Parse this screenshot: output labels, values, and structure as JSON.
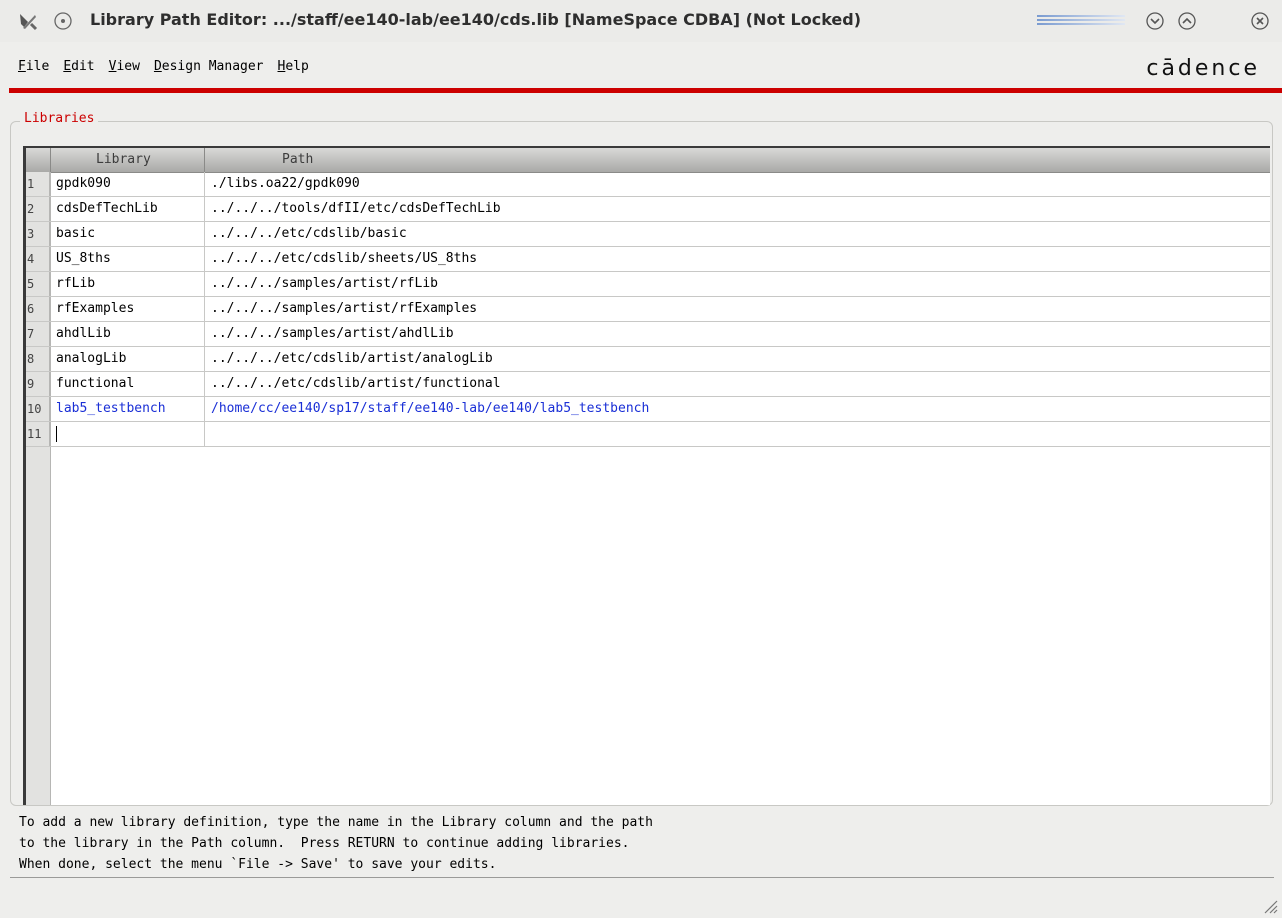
{
  "window": {
    "title": "Library Path Editor: .../staff/ee140-lab/ee140/cds.lib [NameSpace CDBA] (Not Locked)"
  },
  "menu": {
    "items": [
      {
        "label": "File",
        "mnemonic": "F",
        "rest": "ile"
      },
      {
        "label": "Edit",
        "mnemonic": "E",
        "rest": "dit"
      },
      {
        "label": "View",
        "mnemonic": "V",
        "rest": "iew"
      },
      {
        "label": "Design Manager",
        "mnemonic": "D",
        "rest": "esign Manager"
      },
      {
        "label": "Help",
        "mnemonic": "H",
        "rest": "elp"
      }
    ]
  },
  "brand": {
    "logo_text": "cādence"
  },
  "group": {
    "label": "Libraries"
  },
  "table": {
    "columns": [
      "Library",
      "Path"
    ],
    "rows": [
      {
        "num": "1",
        "library": "gpdk090",
        "path": "./libs.oa22/gpdk090"
      },
      {
        "num": "2",
        "library": "cdsDefTechLib",
        "path": "../../../tools/dfII/etc/cdsDefTechLib"
      },
      {
        "num": "3",
        "library": "basic",
        "path": "../../../etc/cdslib/basic"
      },
      {
        "num": "4",
        "library": "US_8ths",
        "path": "../../../etc/cdslib/sheets/US_8ths"
      },
      {
        "num": "5",
        "library": "rfLib",
        "path": "../../../samples/artist/rfLib"
      },
      {
        "num": "6",
        "library": "rfExamples",
        "path": "../../../samples/artist/rfExamples"
      },
      {
        "num": "7",
        "library": "ahdlLib",
        "path": "../../../samples/artist/ahdlLib"
      },
      {
        "num": "8",
        "library": "analogLib",
        "path": "../../../etc/cdslib/artist/analogLib"
      },
      {
        "num": "9",
        "library": "functional",
        "path": "../../../etc/cdslib/artist/functional"
      },
      {
        "num": "10",
        "library": "lab5_testbench",
        "path": "/home/cc/ee140/sp17/staff/ee140-lab/ee140/lab5_testbench"
      },
      {
        "num": "11",
        "library": "",
        "path": ""
      }
    ]
  },
  "help": {
    "line1": "To add a new library definition, type the name in the Library column and the path",
    "line2": "to the library in the Path column.  Press RETURN to continue adding libraries.",
    "line3": "When done, select the menu `File -> Save' to save your edits."
  },
  "colors": {
    "accent_red": "#cc0000",
    "link_blue": "#1a2fd6"
  }
}
